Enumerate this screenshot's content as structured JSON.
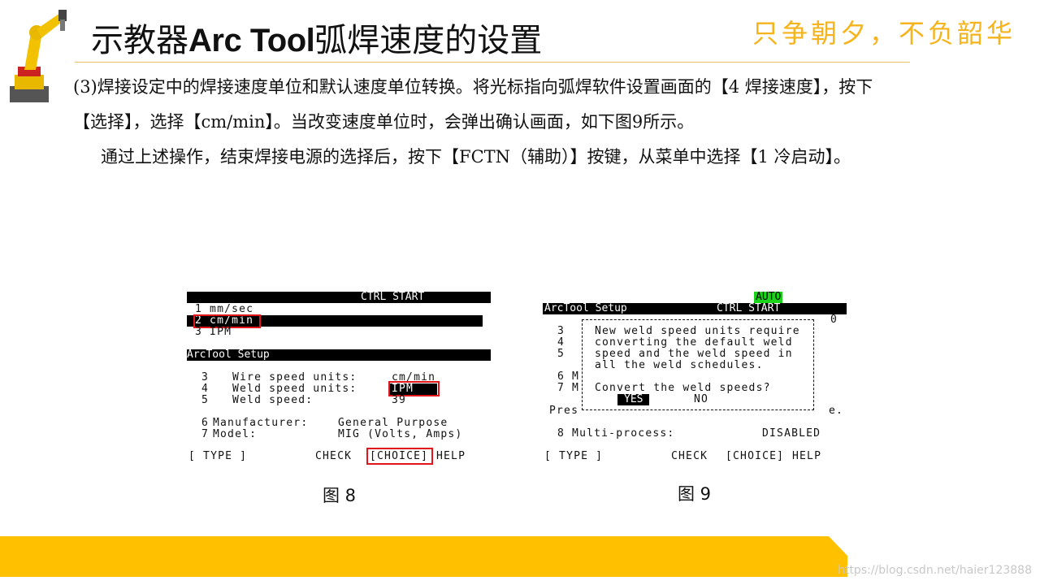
{
  "title": {
    "prefix": "示教器",
    "latin": "Arc Tool",
    "suffix": "弧焊速度的设置"
  },
  "motto": "只争朝夕，不负韶华",
  "paragraph1": "(3)焊接设定中的焊接速度单位和默认速度单位转换。将光标指向弧焊软件设置画面的【4 焊接速度】，按下【选择】，选择【cm/min】。当改变速度单位时，会弹出确认画面，如下图9所示。",
  "paragraph2": "通过上述操作，结束焊接电源的选择后，按下【FCTN（辅助）】按键，从菜单中选择【1 冷启动】。",
  "fig8": {
    "header": "CTRL START",
    "menu": [
      "1 mm/sec",
      "2 cm/min",
      "3 IPM"
    ],
    "setup_title": "ArcTool Setup",
    "rows": [
      {
        "num": "3",
        "label": "Wire speed units:",
        "value": "cm/min"
      },
      {
        "num": "4",
        "label": "Weld speed units:",
        "value": "IPM"
      },
      {
        "num": "5",
        "label": "Weld speed:",
        "value": "39"
      }
    ],
    "rows2": [
      {
        "num": "6",
        "label": "Manufacturer:",
        "value": "General Purpose"
      },
      {
        "num": "7",
        "label": "Model:",
        "value": "MIG (Volts, Amps)"
      }
    ],
    "softkeys": {
      "type": "[ TYPE ]",
      "check": "CHECK",
      "choice": "[CHOICE]",
      "help": "HELP"
    },
    "caption": "图 8"
  },
  "fig9": {
    "auto": "AUTO",
    "title": "ArcTool Setup",
    "header": "CTRL START",
    "right_zero": "0",
    "left_nums": [
      "3",
      "4",
      "5",
      "",
      "6 M",
      "7 M"
    ],
    "dialog_lines": [
      "New weld speed units require",
      "converting the default weld",
      "speed and the weld speed in",
      "all the weld schedules."
    ],
    "question": "Convert the weld speeds?",
    "yes": "YES",
    "no": "NO",
    "pres": "Pres",
    "pres_end": "e.",
    "row8_label": "8 Multi-process:",
    "row8_value": "DISABLED",
    "softkeys": {
      "type": "[ TYPE ]",
      "check": "CHECK",
      "choice": "[CHOICE]",
      "help": "HELP"
    },
    "caption": "图 9"
  },
  "watermark": "https://blog.csdn.net/haier123888",
  "colors": {
    "accent": "#ffc000",
    "motto": "#f5b31c",
    "highlight_red": "#e0161c",
    "auto_green": "#19d419"
  }
}
